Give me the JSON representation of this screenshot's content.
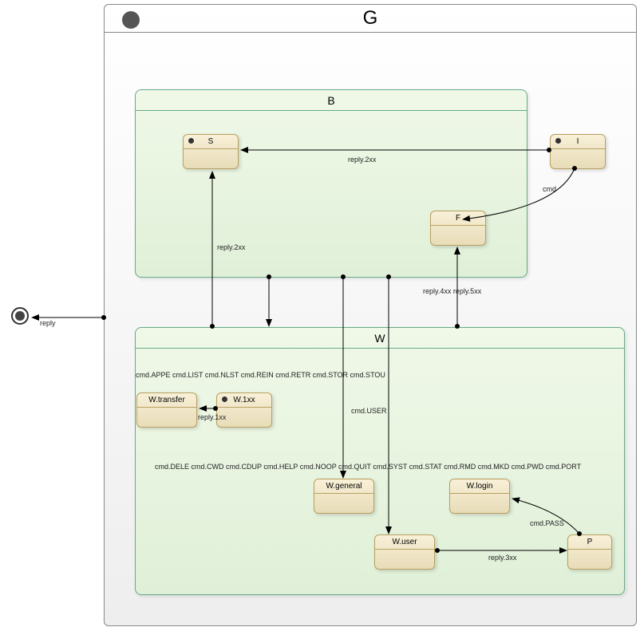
{
  "diagram": {
    "title": "G",
    "composites": {
      "B": {
        "label": "B"
      },
      "W": {
        "label": "W"
      }
    },
    "states": {
      "S": {
        "label": "S",
        "hasInitial": true
      },
      "I": {
        "label": "I",
        "hasInitial": true
      },
      "F": {
        "label": "F",
        "hasInitial": false
      },
      "Wtransfer": {
        "label": "W.transfer",
        "hasInitial": false
      },
      "W1xx": {
        "label": "W.1xx",
        "hasInitial": true
      },
      "Wgeneral": {
        "label": "W.general",
        "hasInitial": false
      },
      "Wlogin": {
        "label": "W.login",
        "hasInitial": false
      },
      "Wuser": {
        "label": "W.user",
        "hasInitial": false
      },
      "P": {
        "label": "P",
        "hasInitial": false
      }
    },
    "edges": {
      "reply_out": "reply",
      "reply2xx_IS": "reply.2xx",
      "cmd_IF": "cmd",
      "reply2xx_WS": "reply.2xx",
      "reply45xx": "reply.4xx reply.5xx",
      "cmdUSER": "cmd.USER",
      "transferCmds": "cmd.APPE cmd.LIST cmd.NLST cmd.REIN cmd.RETR cmd.STOR cmd.STOU",
      "reply1xx": "reply.1xx",
      "generalCmds": "cmd.DELE cmd.CWD cmd.CDUP cmd.HELP cmd.NOOP cmd.QUIT cmd.SYST cmd.STAT cmd.RMD cmd.MKD cmd.PWD cmd.PORT",
      "cmdPASS": "cmd.PASS",
      "reply3xx": "reply.3xx"
    }
  }
}
